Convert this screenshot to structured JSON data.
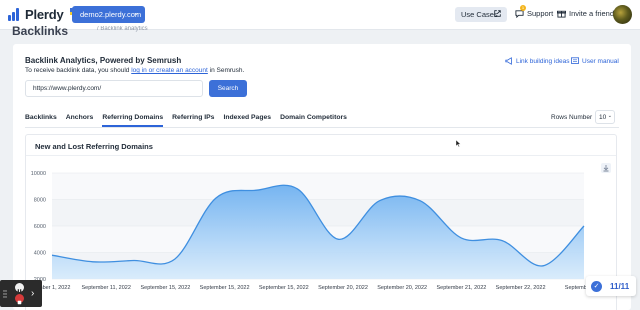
{
  "topbar": {
    "logo_text": "Plerdy",
    "domain": "demo2.plerdy.com",
    "use_cases": "Use Cases",
    "support": "Support",
    "support_badge": "1",
    "invite": "Invite a friend"
  },
  "page": {
    "title": "Backlinks",
    "breadcrumb": "/ Backlink analytics"
  },
  "panel": {
    "title": "Backlink Analytics, Powered by Semrush",
    "sub_before": "To receive backlink data, you should ",
    "sub_link": "log in or create an account",
    "sub_after": " in Semrush.",
    "link_ideas": "Link building ideas",
    "user_manual": "User manual",
    "url_value": "https://www.plerdy.com/",
    "search_label": "Search"
  },
  "tabs": [
    {
      "label": "Backlinks",
      "active": false
    },
    {
      "label": "Anchors",
      "active": false
    },
    {
      "label": "Referring Domains",
      "active": true
    },
    {
      "label": "Referring IPs",
      "active": false
    },
    {
      "label": "Indexed Pages",
      "active": false
    },
    {
      "label": "Domain Competitors",
      "active": false
    }
  ],
  "rows": {
    "label": "Rows Number",
    "value": "10"
  },
  "chart_title": "New and Lost Referring Domains",
  "chart_data": {
    "type": "area",
    "title": "New and Lost Referring Domains",
    "xlabel": "",
    "ylabel": "",
    "ylim": [
      2000,
      10000
    ],
    "yticks": [
      2000,
      4000,
      6000,
      8000,
      10000
    ],
    "categories": [
      "September 1, 2022",
      "September 11, 2022",
      "September 15, 2022",
      "September 15, 2022",
      "September 15, 2022",
      "September 20, 2022",
      "September 20, 2022",
      "September 21, 2022",
      "September 22, 2022",
      "September"
    ],
    "series": [
      {
        "values": [
          3800,
          3300,
          3400,
          3500,
          8100,
          8700,
          8800,
          5000,
          7900,
          7900,
          5100,
          4900,
          3000,
          6000
        ],
        "color": "#6fb1f0"
      }
    ],
    "grid": true
  },
  "recorder": {
    "arrow": "›"
  },
  "progress": {
    "count": "11/11",
    "check": "✓"
  }
}
